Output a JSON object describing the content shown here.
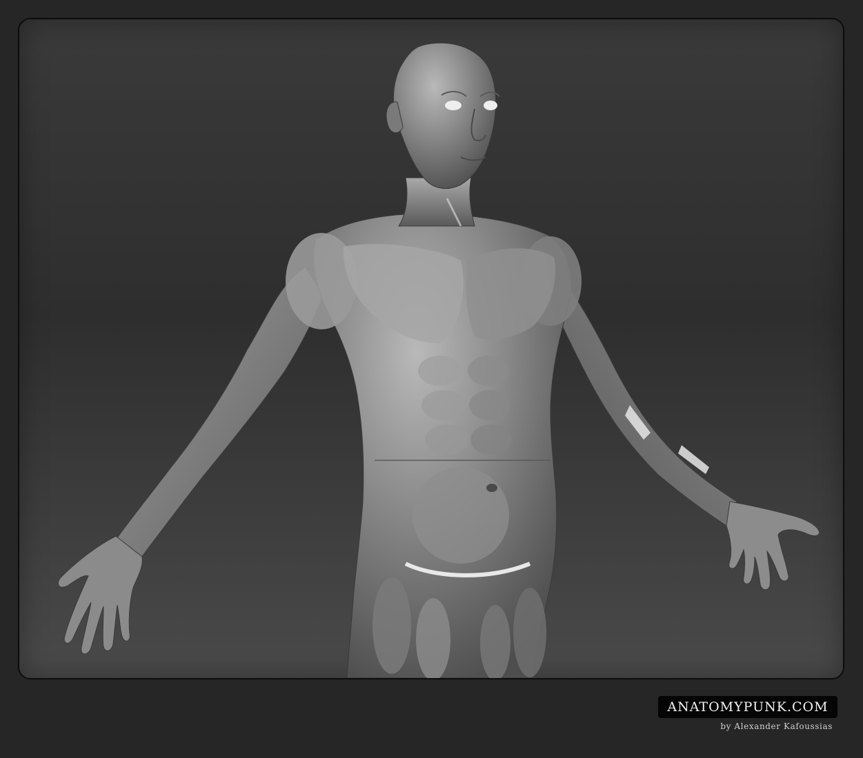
{
  "image": {
    "subject": "grey clay 3D render of a male anatomical figure with outstretched arms, head to upper thighs",
    "frame_background": "#2f2f2f",
    "page_background": "#262626",
    "figure_color": "#8c8c8c",
    "accent_tendons": "#e6e6e6"
  },
  "brand": {
    "title": "ANATOMYPUNK.COM",
    "byline": "by Alexander Kafoussias"
  }
}
